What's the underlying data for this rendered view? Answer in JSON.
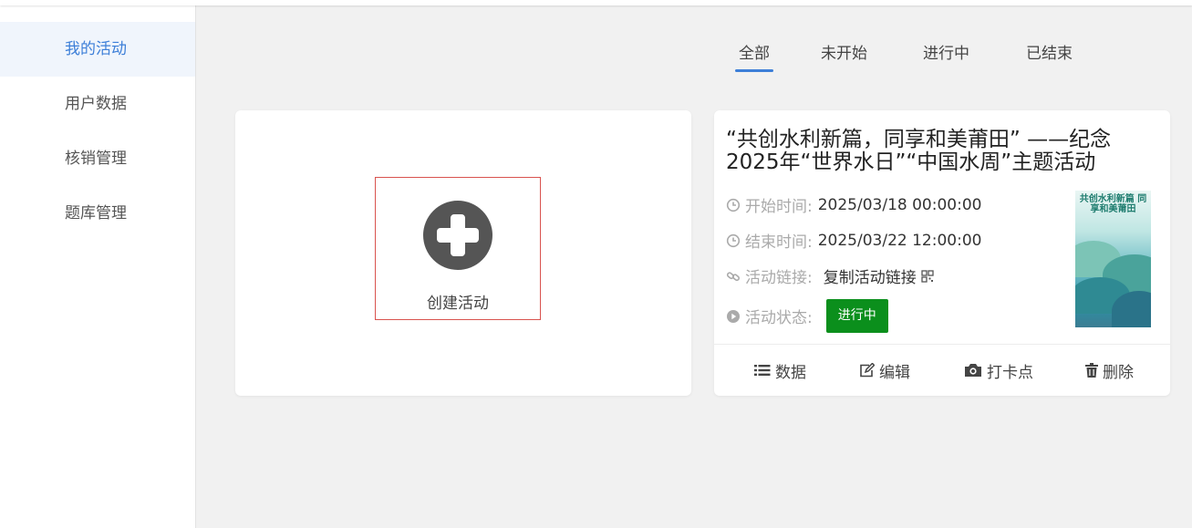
{
  "sidebar": {
    "items": [
      {
        "label": "我的活动",
        "active": true
      },
      {
        "label": "用户数据"
      },
      {
        "label": "核销管理"
      },
      {
        "label": "题库管理"
      }
    ]
  },
  "tabs": [
    {
      "label": "全部",
      "active": true
    },
    {
      "label": "未开始"
    },
    {
      "label": "进行中"
    },
    {
      "label": "已结束"
    }
  ],
  "create": {
    "label": "创建活动"
  },
  "activity": {
    "title": "“共创水利新篇，同享和美莆田” ——纪念2025年“世界水日”“中国水周”主题活动",
    "start_label": "开始时间:",
    "start_value": "2025/03/18 00:00:00",
    "end_label": "结束时间:",
    "end_value": "2025/03/22 12:00:00",
    "link_label": "活动链接:",
    "link_value": "复制活动链接",
    "status_label": "活动状态:",
    "status_value": "进行中",
    "status_color": "#0b8f1c",
    "poster_text": "共创水利新篇 同享和美莆田",
    "actions": [
      {
        "label": "数据",
        "icon": "list-icon"
      },
      {
        "label": "编辑",
        "icon": "edit-icon"
      },
      {
        "label": "打卡点",
        "icon": "camera-icon"
      },
      {
        "label": "删除",
        "icon": "trash-icon"
      }
    ]
  },
  "colors": {
    "accent": "#3d7fd8",
    "status_green": "#0b8f1c",
    "create_border": "#d9534f"
  }
}
